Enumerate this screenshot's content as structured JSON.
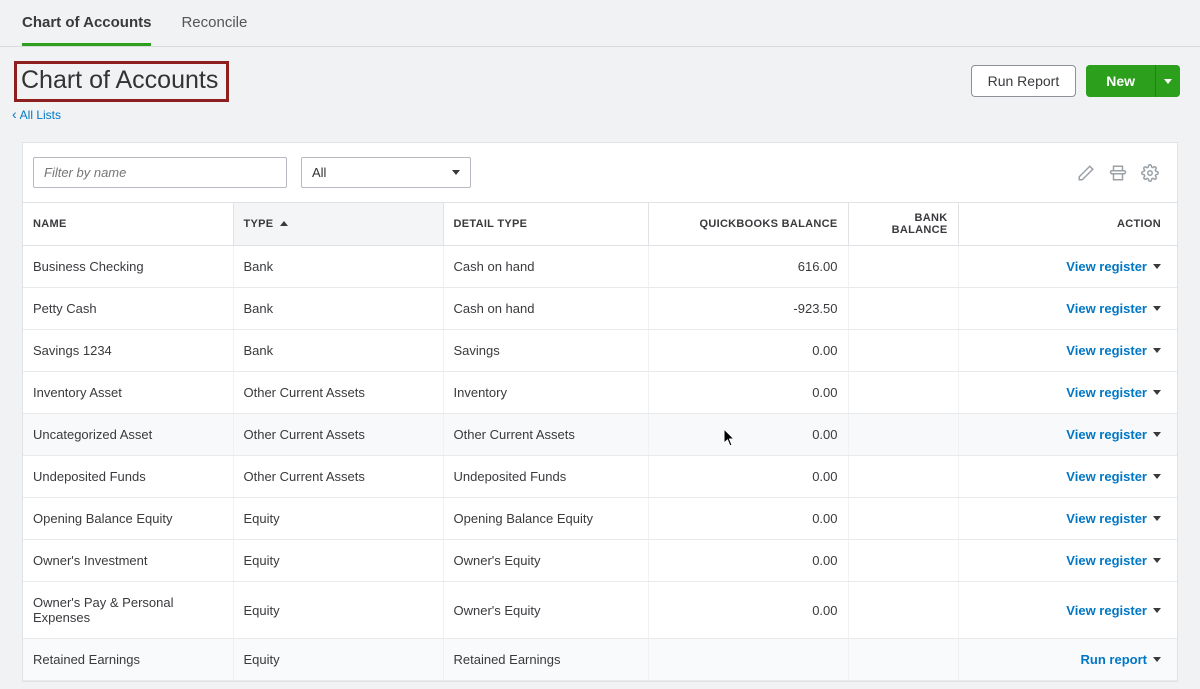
{
  "tabs": {
    "items": [
      {
        "label": "Chart of Accounts",
        "active": true
      },
      {
        "label": "Reconcile",
        "active": false
      }
    ]
  },
  "header": {
    "title": "Chart of Accounts",
    "back_link": "All Lists",
    "run_report_label": "Run Report",
    "new_label": "New"
  },
  "filter": {
    "placeholder": "Filter by name",
    "select_value": "All"
  },
  "columns": {
    "name": "NAME",
    "type": "TYPE",
    "detail": "DETAIL TYPE",
    "qb_balance": "QUICKBOOKS BALANCE",
    "bank_balance": "BANK BALANCE",
    "action": "ACTION"
  },
  "action_labels": {
    "view_register": "View register",
    "run_report": "Run report"
  },
  "accounts": [
    {
      "name": "Business Checking",
      "type": "Bank",
      "detail": "Cash on hand",
      "qb": "616.00",
      "bank": "",
      "action": "view_register"
    },
    {
      "name": "Petty Cash",
      "type": "Bank",
      "detail": "Cash on hand",
      "qb": "-923.50",
      "bank": "",
      "action": "view_register"
    },
    {
      "name": "Savings 1234",
      "type": "Bank",
      "detail": "Savings",
      "qb": "0.00",
      "bank": "",
      "action": "view_register"
    },
    {
      "name": "Inventory Asset",
      "type": "Other Current Assets",
      "detail": "Inventory",
      "qb": "0.00",
      "bank": "",
      "action": "view_register"
    },
    {
      "name": "Uncategorized Asset",
      "type": "Other Current Assets",
      "detail": "Other Current Assets",
      "qb": "0.00",
      "bank": "",
      "action": "view_register",
      "hover": true
    },
    {
      "name": "Undeposited Funds",
      "type": "Other Current Assets",
      "detail": "Undeposited Funds",
      "qb": "0.00",
      "bank": "",
      "action": "view_register"
    },
    {
      "name": "Opening Balance Equity",
      "type": "Equity",
      "detail": "Opening Balance Equity",
      "qb": "0.00",
      "bank": "",
      "action": "view_register"
    },
    {
      "name": "Owner's Investment",
      "type": "Equity",
      "detail": "Owner's Equity",
      "qb": "0.00",
      "bank": "",
      "action": "view_register"
    },
    {
      "name": "Owner's Pay & Personal Expenses",
      "type": "Equity",
      "detail": "Owner's Equity",
      "qb": "0.00",
      "bank": "",
      "action": "view_register"
    },
    {
      "name": "Retained Earnings",
      "type": "Equity",
      "detail": "Retained Earnings",
      "qb": "",
      "bank": "",
      "action": "run_report",
      "striped": true
    }
  ]
}
